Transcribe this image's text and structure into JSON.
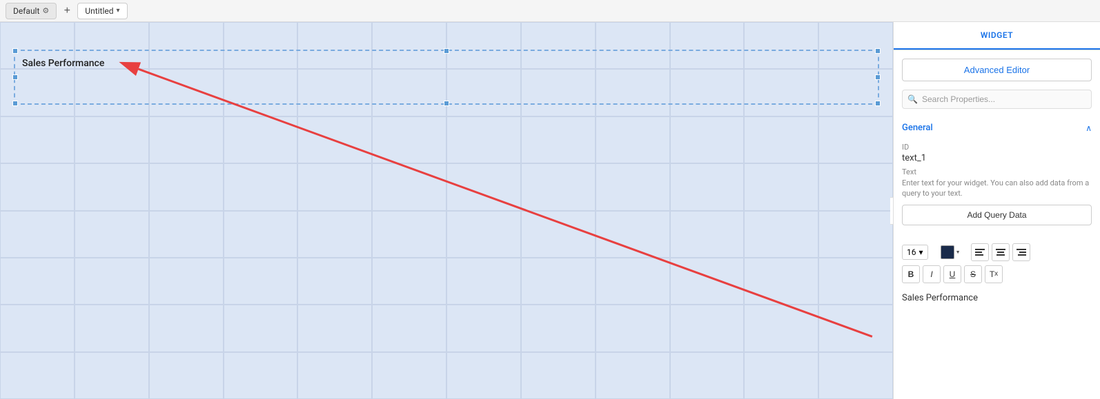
{
  "tabs": {
    "default_label": "Default",
    "add_label": "+",
    "untitled_label": "Untitled"
  },
  "panel": {
    "tab_label": "WIDGET",
    "advanced_editor_btn": "Advanced Editor",
    "search_placeholder": "Search Properties...",
    "general_section": "General",
    "id_label": "ID",
    "id_value": "text_1",
    "text_label": "Text",
    "text_description": "Enter text for your widget. You can also add data from a query to your text.",
    "add_query_btn": "Add Query Data",
    "font_size": "16",
    "text_preview": "Sales Performance"
  },
  "canvas": {
    "widget_title": "Sales Performance"
  }
}
